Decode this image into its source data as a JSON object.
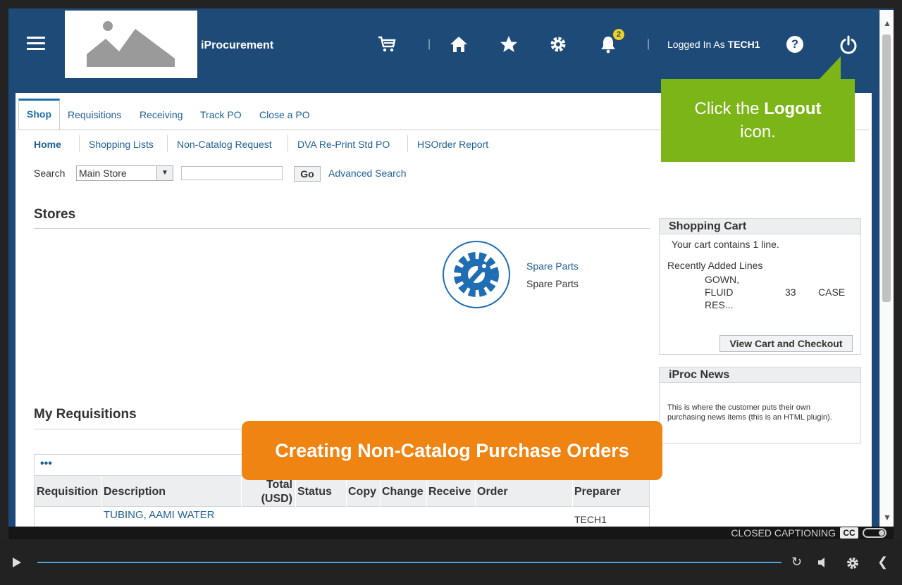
{
  "header": {
    "app_title": "iProcurement",
    "logged_in_label": "Logged In As",
    "username": "TECH1",
    "notification_count": "2",
    "help_label": "?",
    "icons": [
      "menu-icon",
      "cart-icon",
      "home-icon",
      "star-icon",
      "gear-icon",
      "bell-icon",
      "help-icon",
      "power-icon"
    ],
    "colors": {
      "header_bg": "#1d4a77",
      "link": "#1f5f97"
    }
  },
  "tabs": [
    "Shop",
    "Requisitions",
    "Receiving",
    "Track PO",
    "Close a PO"
  ],
  "subnav": [
    "Home",
    "Shopping Lists",
    "Non-Catalog Request",
    "DVA Re-Print Std PO",
    "HSOrder Report"
  ],
  "search": {
    "label": "Search",
    "store": "Main Store",
    "go": "Go",
    "advanced": "Advanced Search"
  },
  "stores": {
    "title": "Stores",
    "store_link": "Spare Parts",
    "store_desc": "Spare Parts"
  },
  "cart": {
    "title": "Shopping Cart",
    "summary": "Your cart contains 1 line.",
    "recent_label": "Recently Added Lines",
    "item_line1": "GOWN,",
    "item_line2": "FLUID",
    "item_line3": "RES...",
    "qty": "33",
    "uom": "CASE",
    "checkout": "View Cart and Checkout"
  },
  "news": {
    "title": "iProc News",
    "text": "This is where the customer puts their own purchasing news items (this is an HTML plugin)."
  },
  "requisitions": {
    "title": "My Requisitions",
    "more": "•••",
    "columns": [
      "Requisition",
      "Description",
      "Total (USD)",
      "Status",
      "Copy",
      "Change",
      "Receive",
      "Order",
      "Preparer"
    ],
    "total_line1": "Total",
    "total_line2": "(USD)",
    "first_row_desc": "TUBING, AAMI WATER",
    "first_row_preparer": "TECH1"
  },
  "callout": {
    "pre": "Click the",
    "bold": "Logout",
    "post": "icon."
  },
  "banner": "Creating Non-Catalog Purchase Orders",
  "captions": {
    "label": "CLOSED CAPTIONING",
    "cc": "CC"
  },
  "player": {
    "icons": [
      "play-icon",
      "replay-icon",
      "volume-icon",
      "settings-icon",
      "back-icon"
    ]
  }
}
